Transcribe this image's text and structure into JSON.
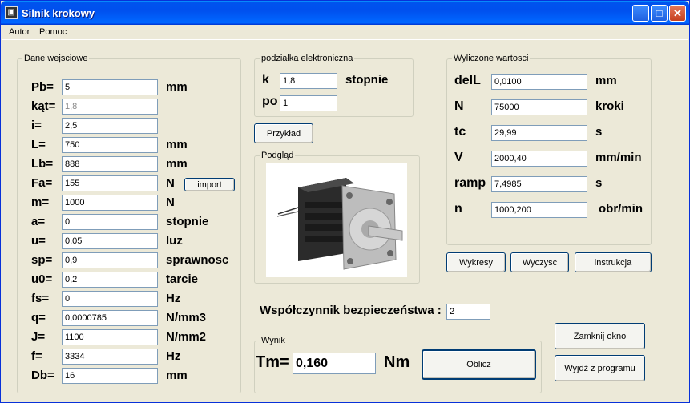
{
  "window": {
    "title": "Silnik krokowy",
    "buttons": {
      "minimize": "_",
      "maximize": "□",
      "close": "✕"
    }
  },
  "menu": {
    "items": [
      "Autor",
      "Pomoc"
    ]
  },
  "inputs_group": {
    "label": "Dane wejsciowe",
    "rows": [
      {
        "label": "Pb=",
        "value": "5",
        "unit": "mm"
      },
      {
        "label": "kąt=",
        "value": "1,8",
        "unit": "",
        "disabled": true
      },
      {
        "label": "i=",
        "value": "2,5",
        "unit": ""
      },
      {
        "label": "L=",
        "value": "750",
        "unit": "mm"
      },
      {
        "label": "Lb=",
        "value": "888",
        "unit": "mm"
      },
      {
        "label": "Fa=",
        "value": "155",
        "unit": "N"
      },
      {
        "label": "m=",
        "value": "1000",
        "unit": "N"
      },
      {
        "label": "a=",
        "value": "0",
        "unit": "stopnie"
      },
      {
        "label": "u=",
        "value": "0,05",
        "unit": "luz"
      },
      {
        "label": "sp=",
        "value": "0,9",
        "unit": "sprawnosc"
      },
      {
        "label": "u0=",
        "value": "0,2",
        "unit": "tarcie"
      },
      {
        "label": "fs=",
        "value": "0",
        "unit": "Hz"
      },
      {
        "label": "q=",
        "value": "0,0000785",
        "unit": "N/mm3"
      },
      {
        "label": "J=",
        "value": "1100",
        "unit": "N/mm2"
      },
      {
        "label": "f=",
        "value": "3334",
        "unit": "Hz"
      },
      {
        "label": "Db=",
        "value": "16",
        "unit": "mm"
      }
    ],
    "import_button": "import"
  },
  "electronic_pitch": {
    "label": "podziałka elektroniczna",
    "k_label": "k",
    "k_value": "1,8",
    "k_unit": "stopnie",
    "po_label": "po",
    "po_value": "1"
  },
  "example_button": "Przykład",
  "preview": {
    "label": "Podgląd"
  },
  "computed": {
    "label": "Wyliczone wartosci",
    "rows": [
      {
        "label": "delL",
        "value": "0,0100",
        "unit": "mm"
      },
      {
        "label": "N",
        "value": "75000",
        "unit": "kroki"
      },
      {
        "label": "tc",
        "value": "29,99",
        "unit": "s"
      },
      {
        "label": "V",
        "value": "2000,40",
        "unit": "mm/min"
      },
      {
        "label": "ramp",
        "value": "7,4985",
        "unit": "s"
      },
      {
        "label": "n",
        "value": "1000,200",
        "unit": "obr/min"
      }
    ]
  },
  "actions": {
    "charts": "Wykresy",
    "clear": "Wyczysc",
    "instructions": "instrukcja"
  },
  "safety": {
    "label": "Współczynnik bezpieczeństwa :",
    "value": "2"
  },
  "result": {
    "label": "Wynik",
    "tm_label": "Tm=",
    "tm_value": "0,160",
    "tm_unit": "Nm",
    "compute_button": "Oblicz"
  },
  "close_window_button": "Zamknij okno",
  "exit_button": "Wyjdź z programu",
  "colors": {
    "titlebar": "#0054e3",
    "window_bg": "#ece9d8",
    "input_border": "#7f9db9",
    "button_border": "#003c74"
  }
}
